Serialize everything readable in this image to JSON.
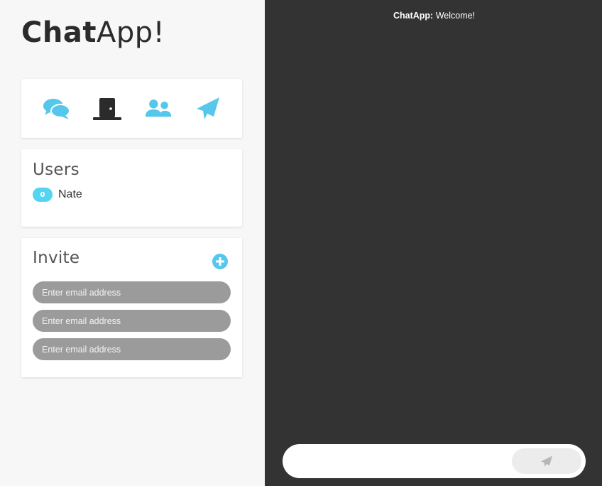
{
  "app": {
    "logo_bold": "Chat",
    "logo_light": "App!"
  },
  "actions": {
    "icons": [
      "chat-bubbles-icon",
      "door-icon",
      "users-icon",
      "paper-plane-icon"
    ],
    "accent_color": "#55c7ea",
    "dark_color": "#2b2b2b"
  },
  "users": {
    "title": "Users",
    "list": [
      {
        "badge": "0",
        "name": "Nate"
      }
    ]
  },
  "invite": {
    "title": "Invite",
    "placeholders": [
      "Enter email address",
      "Enter email address",
      "Enter email address"
    ]
  },
  "chat": {
    "messages": [
      {
        "sender": "ChatApp:",
        "text": "Welcome!"
      }
    ],
    "composer_value": ""
  }
}
